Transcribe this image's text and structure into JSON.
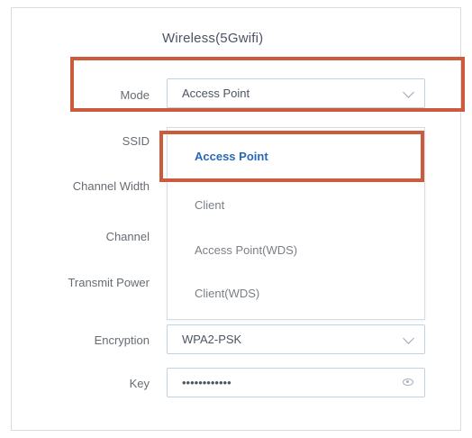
{
  "section": {
    "title": "Wireless(5Gwifi)"
  },
  "fields": {
    "mode": {
      "label": "Mode",
      "value": "Access Point"
    },
    "ssid": {
      "label": "SSID"
    },
    "channel_width": {
      "label": "Channel Width"
    },
    "channel": {
      "label": "Channel"
    },
    "transmit_power": {
      "label": "Transmit Power"
    },
    "encryption": {
      "label": "Encryption",
      "value": "WPA2-PSK"
    },
    "key": {
      "label": "Key",
      "value": "••••••••••••"
    }
  },
  "mode_dropdown": {
    "options": [
      "Access Point",
      "Client",
      "Access Point(WDS)",
      "Client(WDS)"
    ],
    "selected": "Access Point"
  },
  "colors": {
    "accent": "#2869b8",
    "highlight": "#cc5a3c",
    "border": "#bcd3e6"
  }
}
